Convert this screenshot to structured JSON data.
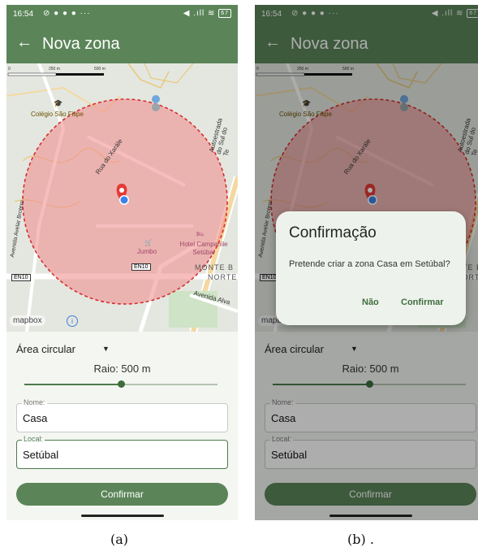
{
  "status_bar": {
    "time": "16:54",
    "notifications": "⊘ ● ● ● ···",
    "system": "◀ .ıll ≋",
    "battery": "67"
  },
  "app_bar": {
    "back_icon": "←",
    "title": "Nova zona"
  },
  "map": {
    "scale_labels": [
      "0",
      "250 m",
      "500 m"
    ],
    "labels": {
      "school": "Colégio São Filipe",
      "street_xarale": "Rua do Xarále",
      "avenue_left": "Avenida Avelar Brotero",
      "highway": "Autoestrada do Sul do Te",
      "jumbo": "Jumbo",
      "hotel": "Hotel Campanile Setúbal",
      "road_code_center": "EN10",
      "road_code_left": "EN10",
      "monte": "MONTE B",
      "norte": "NORTE",
      "avenida_right": "Avenida Alva"
    },
    "attribution": "mapbox",
    "info_icon": "i",
    "colors": {
      "circle_fill": "#f08888",
      "circle_border": "#d62f2f",
      "marker": "#e53935",
      "location_dot": "#3b82e6"
    }
  },
  "form": {
    "area_type": "Área circular",
    "dropdown_icon": "▼",
    "radius_label": "Raio: 500 m",
    "slider_value_percent": 50,
    "name_label": "Nome:",
    "name_value": "Casa",
    "local_label": "Local:",
    "local_value": "Setúbal",
    "confirm_button": "Confirmar"
  },
  "dialog": {
    "title": "Confirmação",
    "message": "Pretende criar a zona Casa em Setúbal?",
    "cancel": "Não",
    "confirm": "Confirmar"
  },
  "captions": {
    "a": "(a)",
    "b": "(b) ."
  },
  "colors": {
    "primary": "#5b8559",
    "primary_dark": "#3f6d3d",
    "surface": "#f4f6f2"
  }
}
